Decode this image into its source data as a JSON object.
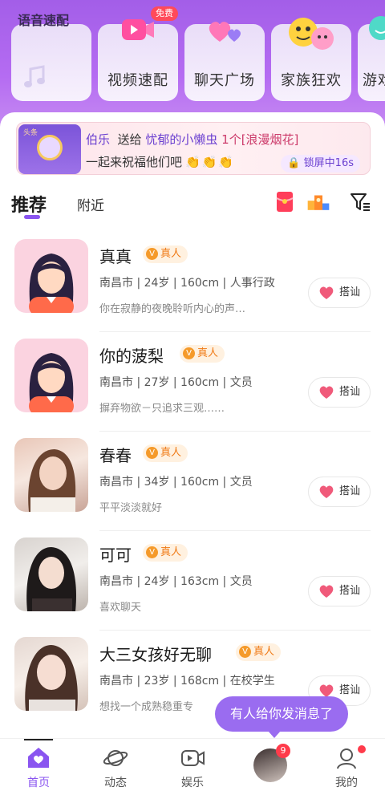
{
  "hero": {
    "voice_title": "语音速配",
    "cards": [
      {
        "label": "视频速配"
      },
      {
        "label": "聊天广场"
      },
      {
        "label": "家族狂欢"
      },
      {
        "label": "游戏"
      }
    ],
    "free_badge": "免费"
  },
  "banner": {
    "logo_tag": "头条",
    "sender": "伯乐",
    "verb": "送给",
    "receiver": "忧郁的小懒虫",
    "gift": "1个[浪漫烟花]",
    "line2": "一起来祝福他们吧",
    "lock_label": "锁屏中16s"
  },
  "tabs": {
    "recommend": "推荐",
    "nearby": "附近"
  },
  "users": [
    {
      "name": "真真",
      "verified": "真人",
      "meta": "南昌市 | 24岁 | 160cm | 人事行政",
      "intro": "你在寂静的夜晚聆听内心的声…",
      "greet": "搭讪"
    },
    {
      "name": "你的菠梨",
      "verified": "真人",
      "meta": "南昌市 | 27岁 | 160cm | 文员",
      "intro": "摒弃物欲－只追求三观……",
      "greet": "搭讪"
    },
    {
      "name": "春春",
      "verified": "真人",
      "meta": "南昌市 | 34岁 | 160cm | 文员",
      "intro": "平平淡淡就好",
      "greet": "搭讪"
    },
    {
      "name": "可可",
      "verified": "真人",
      "meta": "南昌市 | 24岁 | 163cm | 文员",
      "intro": "喜欢聊天",
      "greet": "搭讪"
    },
    {
      "name": "大三女孩好无聊",
      "verified": "真人",
      "meta": "南昌市 | 23岁 | 168cm | 在校学生",
      "intro": "想找一个成熟稳重专",
      "greet": "搭讪"
    }
  ],
  "toast": "有人给你发消息了",
  "nav": {
    "home": "首页",
    "moments": "动态",
    "fun": "娱乐",
    "messages_badge": "9",
    "mine": "我的"
  },
  "colors": {
    "accent": "#8a55f0",
    "hero_top": "#a35ee8",
    "verified": "#f07a16",
    "toast": "#9a6cf0"
  }
}
